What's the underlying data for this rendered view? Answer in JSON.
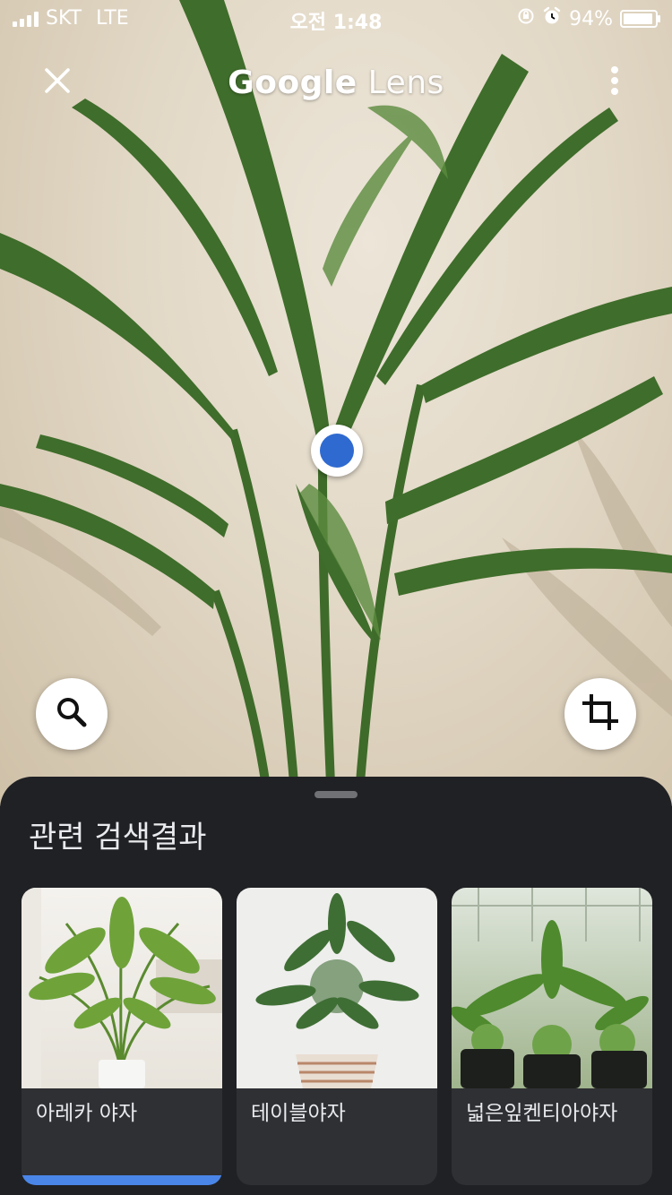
{
  "status_bar": {
    "carrier": "SKT",
    "network": "LTE",
    "time": "오전 1:48",
    "battery_text": "94%",
    "battery_level": 0.94
  },
  "header": {
    "title_brand": "Google",
    "title_product": "Lens"
  },
  "icons": {
    "close": "close-icon",
    "more": "more-vert-icon",
    "search": "search-icon",
    "crop": "crop-icon"
  },
  "sheet": {
    "title": "관련 검색결과",
    "results": [
      {
        "label": "아레카 야자",
        "selected": true
      },
      {
        "label": "테이블야자",
        "selected": false
      },
      {
        "label": "넓은잎켄티아야자",
        "selected": false
      }
    ]
  },
  "colors": {
    "accent": "#4a86e8",
    "sheet_bg": "#202124",
    "card_bg": "#2f3034",
    "selection_dot": "#2f6ad0"
  }
}
